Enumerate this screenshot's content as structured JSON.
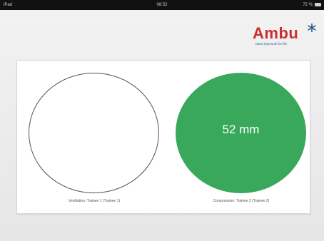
{
  "status_bar": {
    "carrier": "iPad",
    "time": "08:52",
    "battery_percent": "72 %"
  },
  "brand": {
    "name": "Ambu",
    "tagline": "Ideas that work for life",
    "logo_color": "#c9302c",
    "tagline_color": "#2a5a8a",
    "logo_mark_icon": "asterisk-star-icon"
  },
  "monitor": {
    "ventilation": {
      "label": "Ventilation: Trainee 1 (Trainee 1)"
    },
    "compression": {
      "value_text": "52 mm",
      "label": "Compression: Trainee 2 (Trainee 2)",
      "fill_color": "#3aa85a"
    }
  }
}
